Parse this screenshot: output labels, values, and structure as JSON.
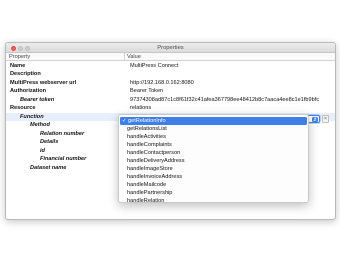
{
  "window": {
    "title": "Properties"
  },
  "columns": {
    "property": "Property",
    "value": "Value"
  },
  "rows": [
    {
      "key": "Name",
      "value": "MultiPress Connect"
    },
    {
      "key": "Description",
      "value": ""
    },
    {
      "key": "MultiPress webserver url",
      "value": "http://192.168.0.162:8080"
    },
    {
      "key": "Authorization",
      "value": "Bearer Token"
    },
    {
      "key": "Bearer token",
      "value": "97374308ad87c1c8f61f32c41afea367798ee48412b8c7aaca4ee8c1e1fb9bfc"
    },
    {
      "key": "Resource",
      "value": "relations"
    },
    {
      "key": "Function",
      "value": ""
    },
    {
      "key": "Method",
      "value": ""
    },
    {
      "key": "Relation number",
      "value": ""
    },
    {
      "key": "Details",
      "value": ""
    },
    {
      "key": "id",
      "value": ""
    },
    {
      "key": "Financial number",
      "value": ""
    },
    {
      "key": "Dataset name",
      "value": ""
    }
  ],
  "function_select": {
    "selected": "getRelationInfo",
    "arrow_icon": "updown-chevron-icon",
    "clear_label": "×",
    "check_mark": "✓",
    "options": [
      "getRelationInfo",
      "getRelationsList",
      "handleActivities",
      "handleComplaints",
      "handleContactperson",
      "handleDeliveryAddress",
      "handleImageStore",
      "handleInvoiceAddress",
      "handleMailcode",
      "handlePartnership",
      "handleRelation"
    ]
  },
  "colors": {
    "accent": "#3d7fe6",
    "close": "#fc5f57"
  }
}
